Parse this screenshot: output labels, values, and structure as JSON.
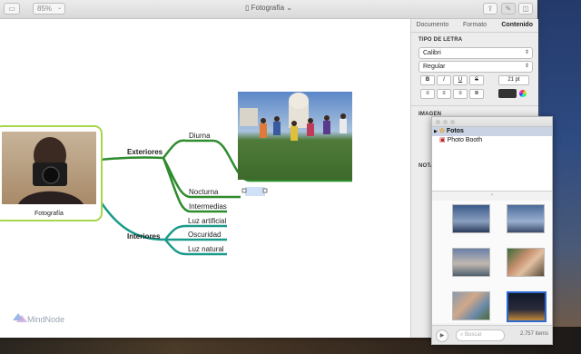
{
  "window": {
    "title": "Fotografía",
    "zoom": "85%",
    "brand": "MindNode"
  },
  "map": {
    "root_label": "Fotografía",
    "exteriores": "Exteriores",
    "interiores": "Interiores",
    "diurna": "Diurna",
    "nocturna": "Nocturna",
    "intermedias": "Intermedias",
    "luz_artificial": "Luz artificial",
    "oscuridad": "Oscuridad",
    "luz_natural": "Luz natural"
  },
  "inspector": {
    "tabs": [
      "Documento",
      "Formato",
      "Contenido"
    ],
    "active_tab": "Contenido",
    "font_section": "TIPO DE LETRA",
    "font_family": "Calibri",
    "font_style": "Regular",
    "bold": "B",
    "italic": "I",
    "underline": "U",
    "strike": "S",
    "font_size": "21 pt",
    "image_section": "IMAGEN",
    "notes_section": "NOTA"
  },
  "media_browser": {
    "sources": [
      {
        "label": "Fotos",
        "selected": true
      },
      {
        "label": "Photo Booth",
        "selected": false
      }
    ],
    "search_placeholder": "Buscar",
    "items_count": "2.757 items"
  },
  "colors": {
    "exteriores_branch": "#2e8b2e",
    "interiores_branch": "#1a9a8a",
    "root_border": "#a8d64a"
  }
}
